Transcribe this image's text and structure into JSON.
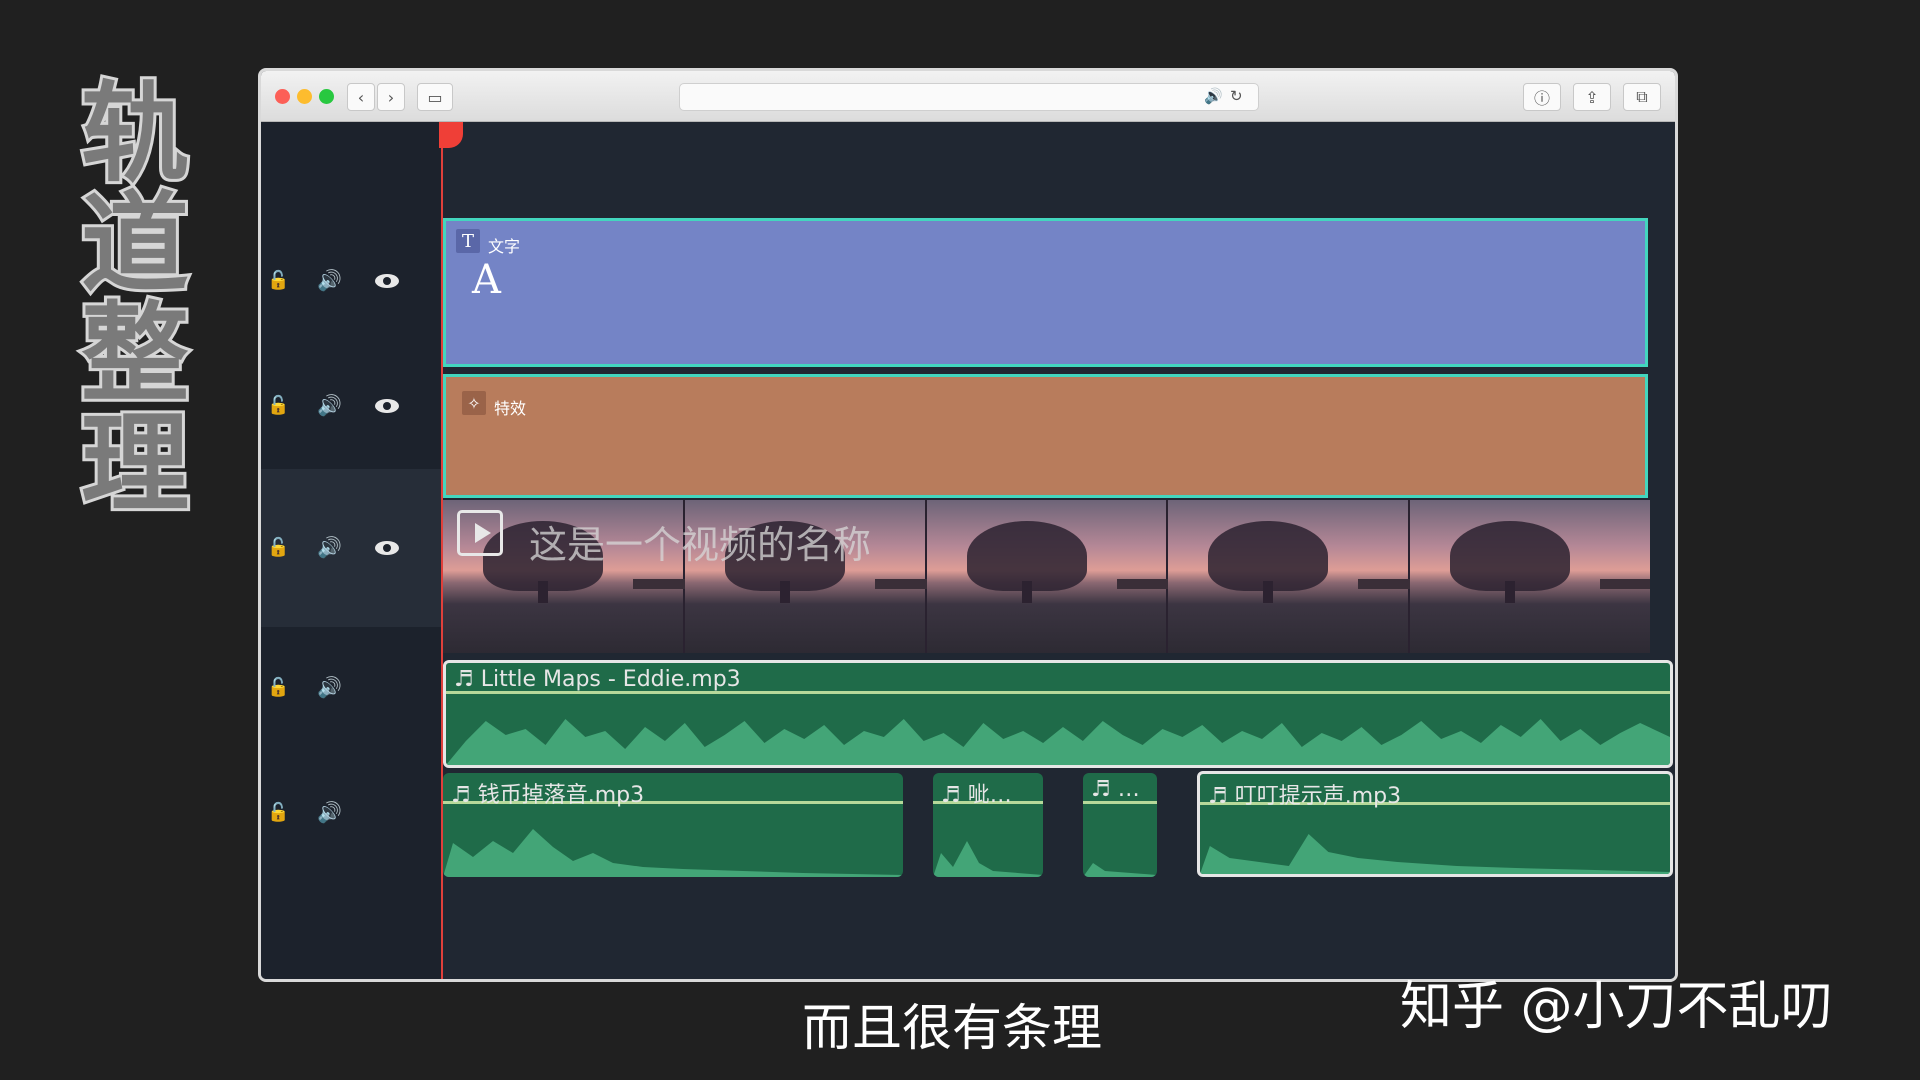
{
  "side_title": [
    "轨",
    "道",
    "整",
    "理"
  ],
  "browser": {
    "nav_back": "‹",
    "nav_forward": "›",
    "sidebar_icon": "▭",
    "url_audio_icon": "🔊",
    "url_reload_icon": "↻",
    "right_icons": [
      "ⓘ",
      "⇪",
      "⧉"
    ]
  },
  "tracks": {
    "lock_icon": "🔓",
    "speaker_icon": "🔊"
  },
  "clips": {
    "text": {
      "tag": "T",
      "label": "文字",
      "glyph": "A"
    },
    "effect": {
      "tag": "✧",
      "label": "特效"
    },
    "video": {
      "title": "这是一个视频的名称"
    },
    "audio_main": {
      "name": "♬ Little Maps - Eddie.mp3"
    },
    "audio_sub": [
      {
        "name": "♬ 钱币掉落音.mp3"
      },
      {
        "name": "♬ 呲…"
      },
      {
        "name": "♬ …"
      },
      {
        "name": "♬ 叮叮提示声.mp3"
      }
    ]
  },
  "colors": {
    "text_clip": "#7484c6",
    "effect_clip": "#b87c5c",
    "audio_clip": "#1f6b49",
    "selection": "#43d6be",
    "playhead": "#e0403b"
  },
  "subtitle": "而且很有条理",
  "watermark": "知乎 @小刀不乱叨"
}
